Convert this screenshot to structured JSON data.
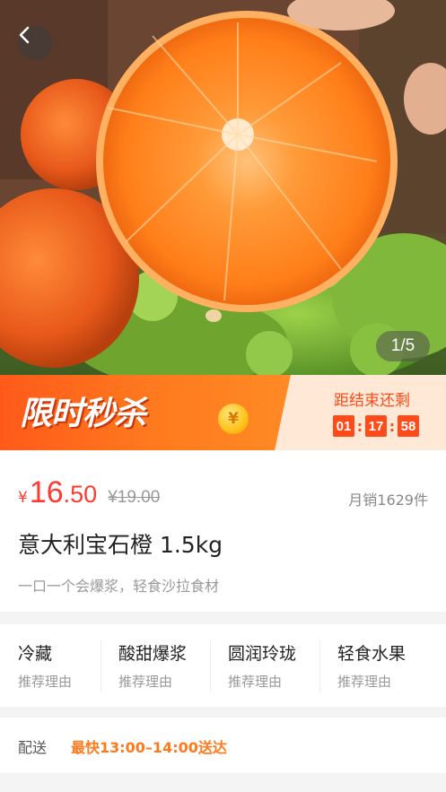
{
  "hero": {
    "pager": "1/5"
  },
  "flash_sale": {
    "title": "限时秒杀",
    "coin_symbol": "¥",
    "countdown_label": "距结束还剩",
    "hours": "01",
    "minutes": "17",
    "seconds": "58"
  },
  "product": {
    "currency": "¥",
    "price_int": "16",
    "price_dec": ".50",
    "original_price": "¥19.00",
    "monthly_sales": "月销1629件",
    "title": "意大利宝石橙 1.5kg",
    "subtitle": "一口一个会爆浆，轻食沙拉食材"
  },
  "tags": [
    {
      "name": "冷藏",
      "desc": "推荐理由"
    },
    {
      "name": "酸甜爆浆",
      "desc": "推荐理由"
    },
    {
      "name": "圆润玲珑",
      "desc": "推荐理由"
    },
    {
      "name": "轻食水果",
      "desc": "推荐理由"
    }
  ],
  "delivery": {
    "label": "配送",
    "value": "最快13:00–14:00送达"
  },
  "colors": {
    "accent": "#ff3b30",
    "orange": "#ff7a1e",
    "flash_bg_light": "#ffe9d6"
  }
}
